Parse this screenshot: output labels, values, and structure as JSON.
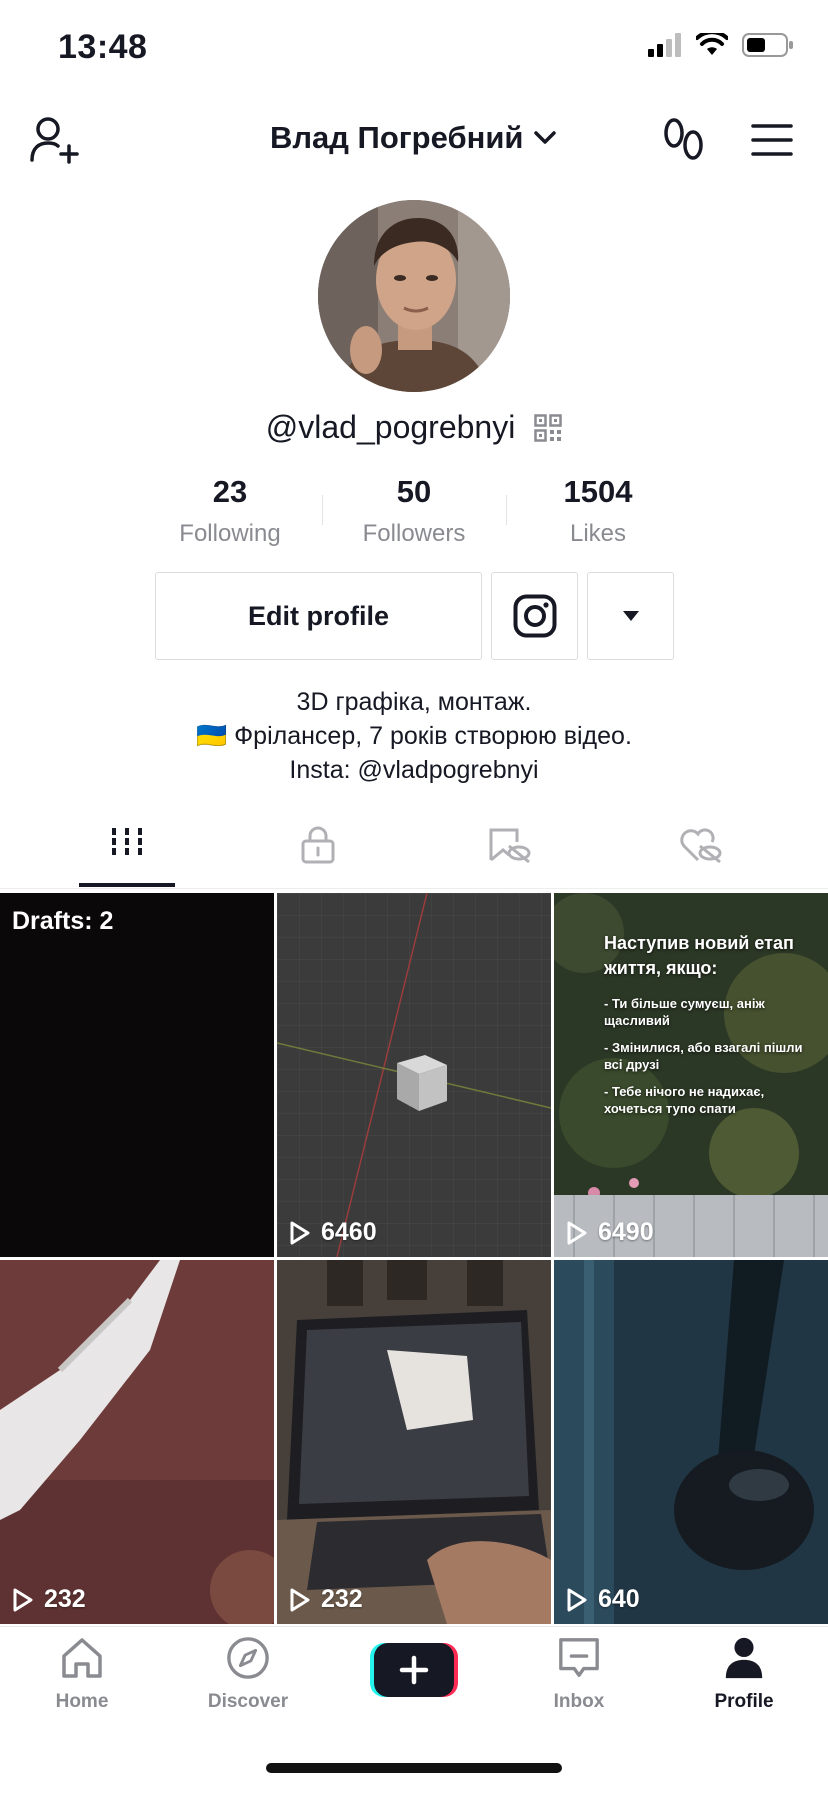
{
  "status_bar": {
    "time": "13:48"
  },
  "header": {
    "title": "Влад Погребний"
  },
  "profile": {
    "username": "@vlad_pogrebnyi",
    "stats": [
      {
        "value": "23",
        "label": "Following"
      },
      {
        "value": "50",
        "label": "Followers"
      },
      {
        "value": "1504",
        "label": "Likes"
      }
    ],
    "edit_button": "Edit profile",
    "bio": [
      "3D графіка, монтаж.",
      "🇺🇦 Фрілансер, 7 років створюю відео.",
      "Insta: @vladpogrebnyi"
    ]
  },
  "tabs": [
    "videos-grid-icon",
    "lock-icon",
    "hidden-likes-icon",
    "liked-icon"
  ],
  "videos": [
    {
      "drafts": "Drafts: 2"
    },
    {
      "views": "6460"
    },
    {
      "views": "6490",
      "heading": "Наступив новий етап життя, якщо:",
      "lines": [
        "- Ти більше сумуєш, аніж щасливий",
        "- Змінилися, або взагалі пішли всі друзі",
        "- Тебе нічого не надихає, хочеться тупо спати"
      ]
    },
    {
      "views": "232"
    },
    {
      "views": "232"
    },
    {
      "views": "640"
    }
  ],
  "nav": [
    "Home",
    "Discover",
    "",
    "Inbox",
    "Profile"
  ],
  "colors": {
    "accent_cyan": "#25F4EE",
    "accent_red": "#FE2C55",
    "text": "#161823",
    "muted": "#8A8B91"
  }
}
